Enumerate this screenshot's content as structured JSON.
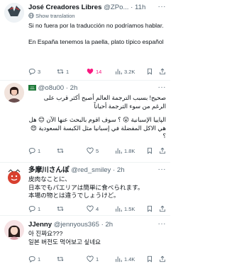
{
  "show_translation_label": "Show translation",
  "tweets": [
    {
      "name": "José Creadores Libres",
      "handle": "@ZPo...",
      "sep": "·",
      "time": "11h",
      "show_translation": true,
      "lines": [
        "Si no fuera por la traducción no podríamos hablar."
      ],
      "lines2": [
        "En España tenemos la paella, plato típico español"
      ],
      "replies": "3",
      "retweets": "1",
      "likes": "14",
      "views": "3.2K",
      "liked": true
    },
    {
      "name": "",
      "handle": "@o8u00",
      "sep": "·",
      "time": "2h",
      "flag": "saudi-flag",
      "show_translation": false,
      "lines": [
        "صحيح! بسبب الترجمة العالم أصبح أكثر قرب على الرغم من سوء الترجمة أحياناً"
      ],
      "lines2": [
        "الپاييا الإسبانية 😲 ؟ سوف اقوم بالبحث عنها الآن 😊 هل هي الاكل المفضلة في إسبانيا مثل الكبسة السعودية 😍 ؟"
      ],
      "replies": "1",
      "retweets": "",
      "likes": "5",
      "views": "1.8K",
      "liked": false
    },
    {
      "name": "多摩川さんぽ",
      "handle": "@red_smiley",
      "sep": "·",
      "time": "2h",
      "show_translation": false,
      "lines": [
        "皮肉なことに、",
        "日本でもパエリアは簡単に食べられます。",
        "本場の物とは違うでしょうけど。"
      ],
      "lines2": [],
      "replies": "1",
      "retweets": "",
      "likes": "4",
      "views": "1.5K",
      "liked": false
    },
    {
      "name": "JJenny",
      "handle": "@jennyous365",
      "sep": "·",
      "time": "2h",
      "show_translation": false,
      "lines": [
        "아 진짜요???",
        "일본 버전도 먹어보고 싶네요"
      ],
      "lines2": [],
      "replies": "1",
      "retweets": "",
      "likes": "1",
      "views": "1.4K",
      "liked": false
    }
  ],
  "colors": {
    "text": "#0f1419",
    "muted": "#536471",
    "like_active": "#f91880",
    "divider": "#eff3f4"
  },
  "icons": [
    "reply-icon",
    "retweet-icon",
    "like-icon",
    "views-icon",
    "bookmark-icon",
    "share-icon",
    "globe-icon",
    "more-icon"
  ]
}
